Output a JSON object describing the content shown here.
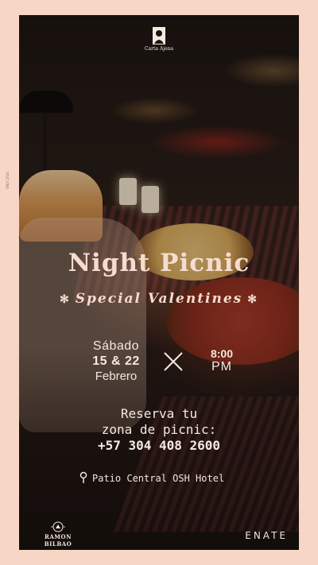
{
  "header": {
    "logo_text": "Carta Ajena",
    "logo_icon": "portrait-logo-icon"
  },
  "event": {
    "title": "Night Picnic",
    "subtitle": "Special Valentines",
    "subtitle_ornament": "✻"
  },
  "schedule": {
    "day": "Sábado",
    "dates": "15 & 22",
    "month": "Febrero",
    "separator_icon": "x-icon",
    "time": "8:00",
    "period": "PM"
  },
  "reservation": {
    "line1": "Reserva tu",
    "line2": "zona de picnic:",
    "phone": "+57 304 408 2600"
  },
  "location": {
    "icon": "map-pin-icon",
    "text": "Patio Central OSH Hotel"
  },
  "footer": {
    "brand_left": "RAMON BILBAO",
    "brand_right": "ENATE"
  },
  "side_note": "ONLY 2024",
  "colors": {
    "frame": "#f7d6c6",
    "text_light": "#f6dccf",
    "background_dark": "#1a1412"
  }
}
